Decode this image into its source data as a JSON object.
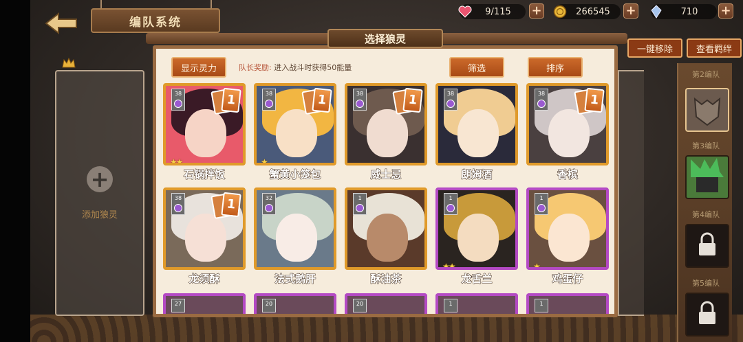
{
  "header": {
    "title": "编队系统",
    "panel_title": "选择狼灵"
  },
  "resources": [
    {
      "name": "stamina",
      "icon": "heart-icon",
      "value": "9/115"
    },
    {
      "name": "gold",
      "icon": "coin-icon",
      "value": "266545"
    },
    {
      "name": "crystal",
      "icon": "crystal-icon",
      "value": "710"
    }
  ],
  "right_buttons": {
    "clear": "一键移除",
    "view": "查看羁绊"
  },
  "panel": {
    "show_power": "显示灵力",
    "captain_label": "队长奖励:",
    "captain_value": "进入战斗时获得50能量",
    "filter": "筛选",
    "sort": "排序"
  },
  "slots": {
    "add_label": "添加狼灵"
  },
  "teams": [
    {
      "label": "第2编队",
      "state": "active"
    },
    {
      "label": "第3编队",
      "state": "preview"
    },
    {
      "label": "第4编队",
      "state": "locked"
    },
    {
      "label": "第5编队",
      "state": "locked"
    }
  ],
  "cards": [
    {
      "name": "石锅拌饭",
      "level": "38",
      "frame": "gold",
      "stars": 2,
      "copies": "1",
      "hair": "#3a1a26",
      "face": "#f6d4c6",
      "bg": "#e85a6a"
    },
    {
      "name": "蟹黄小笼包",
      "level": "38",
      "frame": "gold",
      "stars": 1,
      "copies": "1",
      "hair": "#f2b642",
      "face": "#f8e0c6",
      "bg": "#4a5a7a"
    },
    {
      "name": "威士忌",
      "level": "38",
      "frame": "gold",
      "stars": 0,
      "copies": "1",
      "hair": "#6e5a4e",
      "face": "#f0dcd0",
      "bg": "#3a3030"
    },
    {
      "name": "朗姆酒",
      "level": "38",
      "frame": "gold",
      "stars": 0,
      "copies": "",
      "hair": "#f0cc92",
      "face": "#f8e6d2",
      "bg": "#2a2a3a"
    },
    {
      "name": "香槟",
      "level": "38",
      "frame": "gold",
      "stars": 0,
      "copies": "1",
      "hair": "#cfc6c6",
      "face": "#f2e6e0",
      "bg": "#4a4040"
    },
    {
      "name": "龙须酥",
      "level": "38",
      "frame": "gold",
      "stars": 0,
      "copies": "1",
      "hair": "#e8e2dc",
      "face": "#f6e0d6",
      "bg": "#7a6a5a"
    },
    {
      "name": "法式鹅肝",
      "level": "32",
      "frame": "gold",
      "stars": 0,
      "copies": "",
      "hair": "#c8d4c8",
      "face": "#f8ece6",
      "bg": "#6a7a8a"
    },
    {
      "name": "酥油茶",
      "level": "1",
      "frame": "gold",
      "stars": 0,
      "copies": "",
      "hair": "#e8e2d6",
      "face": "#b88a6a",
      "bg": "#5a3a2a"
    },
    {
      "name": "龙舌兰",
      "level": "1",
      "frame": "purple",
      "stars": 2,
      "copies": "",
      "hair": "#c89a3a",
      "face": "#f4dcc0",
      "bg": "#2a2420"
    },
    {
      "name": "鸡蛋仔",
      "level": "1",
      "frame": "purple",
      "stars": 1,
      "copies": "",
      "hair": "#f6c872",
      "face": "#fbe6d2",
      "bg": "#6a5040"
    }
  ],
  "partial_cards": [
    {
      "level": "27"
    },
    {
      "level": "20"
    },
    {
      "level": "20"
    },
    {
      "level": "1"
    },
    {
      "level": "1"
    }
  ]
}
